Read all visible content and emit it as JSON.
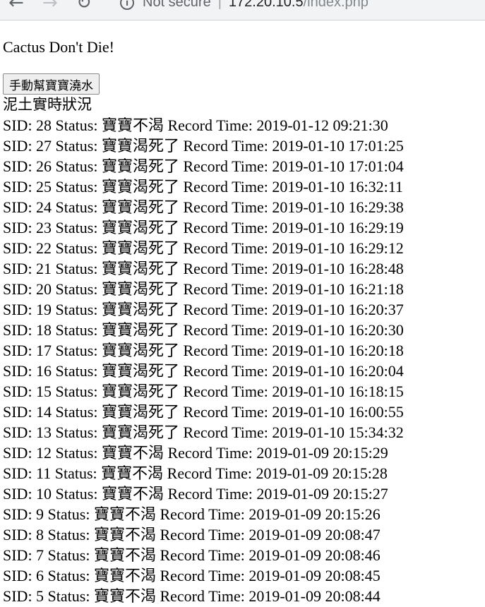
{
  "browser": {
    "security_label": "Not secure",
    "url_host": "172.20.10.5",
    "url_path": "/index.php"
  },
  "page": {
    "title": "Cactus Don't Die!",
    "water_button_label": "手動幫寶寶澆水",
    "soil_heading": "泥土實時狀況"
  },
  "records": [
    {
      "text": "SID: 28 Status: 寶寶不渴 Record Time: 2019-01-12 09:21:30"
    },
    {
      "text": "SID: 27 Status: 寶寶渴死了 Record Time: 2019-01-10 17:01:25"
    },
    {
      "text": "SID: 26 Status: 寶寶渴死了 Record Time: 2019-01-10 17:01:04"
    },
    {
      "text": "SID: 25 Status: 寶寶渴死了 Record Time: 2019-01-10 16:32:11"
    },
    {
      "text": "SID: 24 Status: 寶寶渴死了 Record Time: 2019-01-10 16:29:38"
    },
    {
      "text": "SID: 23 Status: 寶寶渴死了 Record Time: 2019-01-10 16:29:19"
    },
    {
      "text": "SID: 22 Status: 寶寶渴死了 Record Time: 2019-01-10 16:29:12"
    },
    {
      "text": "SID: 21 Status: 寶寶渴死了 Record Time: 2019-01-10 16:28:48"
    },
    {
      "text": "SID: 20 Status: 寶寶渴死了 Record Time: 2019-01-10 16:21:18"
    },
    {
      "text": "SID: 19 Status: 寶寶渴死了 Record Time: 2019-01-10 16:20:37"
    },
    {
      "text": "SID: 18 Status: 寶寶渴死了 Record Time: 2019-01-10 16:20:30"
    },
    {
      "text": "SID: 17 Status: 寶寶渴死了 Record Time: 2019-01-10 16:20:18"
    },
    {
      "text": "SID: 16 Status: 寶寶渴死了 Record Time: 2019-01-10 16:20:04"
    },
    {
      "text": "SID: 15 Status: 寶寶渴死了 Record Time: 2019-01-10 16:18:15"
    },
    {
      "text": "SID: 14 Status: 寶寶渴死了 Record Time: 2019-01-10 16:00:55"
    },
    {
      "text": "SID: 13 Status: 寶寶渴死了 Record Time: 2019-01-10 15:34:32"
    },
    {
      "text": "SID: 12 Status: 寶寶不渴 Record Time: 2019-01-09 20:15:29"
    },
    {
      "text": "SID: 11 Status: 寶寶不渴 Record Time: 2019-01-09 20:15:28"
    },
    {
      "text": "SID: 10 Status: 寶寶不渴 Record Time: 2019-01-09 20:15:27"
    },
    {
      "text": "SID: 9 Status: 寶寶不渴 Record Time: 2019-01-09 20:15:26"
    },
    {
      "text": "SID: 8 Status: 寶寶不渴 Record Time: 2019-01-09 20:08:47"
    },
    {
      "text": "SID: 7 Status: 寶寶不渴 Record Time: 2019-01-09 20:08:46"
    },
    {
      "text": "SID: 6 Status: 寶寶不渴 Record Time: 2019-01-09 20:08:45"
    },
    {
      "text": "SID: 5 Status: 寶寶不渴 Record Time: 2019-01-09 20:08:44"
    }
  ]
}
